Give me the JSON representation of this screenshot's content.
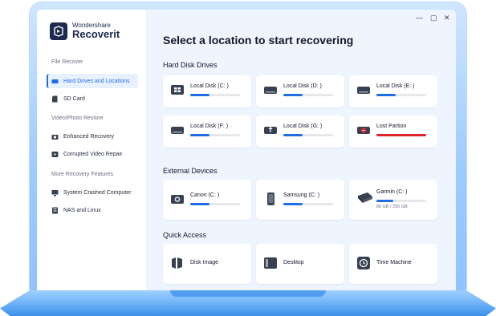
{
  "app": {
    "brand_line1": "Wondershare",
    "brand_line2": "Recoverit",
    "window_controls": {
      "minimize": "—",
      "maximize": "▢",
      "close": "✕"
    }
  },
  "sidebar": {
    "section_file_recover": "File Recover",
    "items_file": [
      {
        "label": "Hard Drives and Locations",
        "icon": "hard-drive-icon",
        "active": true
      },
      {
        "label": "SD Card",
        "icon": "sd-card-icon",
        "active": false
      }
    ],
    "section_video": "Video/Photo Restore",
    "items_video": [
      {
        "label": "Enhanced Recovery",
        "icon": "camera-icon"
      },
      {
        "label": "Corrupted Video Repair",
        "icon": "video-repair-icon"
      }
    ],
    "section_more": "More Recovery Features",
    "items_more": [
      {
        "label": "System Crashed Computer",
        "icon": "monitor-icon"
      },
      {
        "label": "NAS and Linux",
        "icon": "nas-icon"
      }
    ]
  },
  "main": {
    "title": "Select a location to start recovering",
    "hard_disk_heading": "Hard Disk Drives",
    "hard_disks": [
      {
        "name": "Local Disk (C: )",
        "icon": "windows-disk-icon",
        "usage": 0.38,
        "color": "#1e6fe6"
      },
      {
        "name": "Local Disk (D: )",
        "icon": "disk-icon",
        "usage": 0.38,
        "color": "#1e6fe6"
      },
      {
        "name": "Local Disk (E: )",
        "icon": "disk-icon",
        "usage": 0.38,
        "color": "#1e6fe6"
      },
      {
        "name": "Local Disk (F: )",
        "icon": "disk-icon",
        "usage": 0.38,
        "color": "#1e6fe6"
      },
      {
        "name": "Local Disk (G: )",
        "icon": "usb-disk-icon",
        "usage": 0.38,
        "color": "#1e6fe6"
      },
      {
        "name": "Lost Partion",
        "icon": "lost-partition-icon",
        "usage": 1.0,
        "color": "#e0242b"
      }
    ],
    "external_heading": "External Devices",
    "external": [
      {
        "name": "Canon (C: )",
        "icon": "camera-device-icon",
        "usage": 0.38
      },
      {
        "name": "Samsung (C: )",
        "icon": "phone-icon",
        "usage": 0.38
      },
      {
        "name": "Garmin (C: )",
        "icon": "external-drive-icon",
        "usage": 0.34,
        "capacity": "86 GB / 250 GB"
      }
    ],
    "quick_heading": "Quick Access",
    "quick": [
      {
        "name": "Disk Image",
        "icon": "disk-image-icon"
      },
      {
        "name": "Desktop",
        "icon": "desktop-icon"
      },
      {
        "name": "Time Machine",
        "icon": "time-machine-icon"
      }
    ]
  }
}
